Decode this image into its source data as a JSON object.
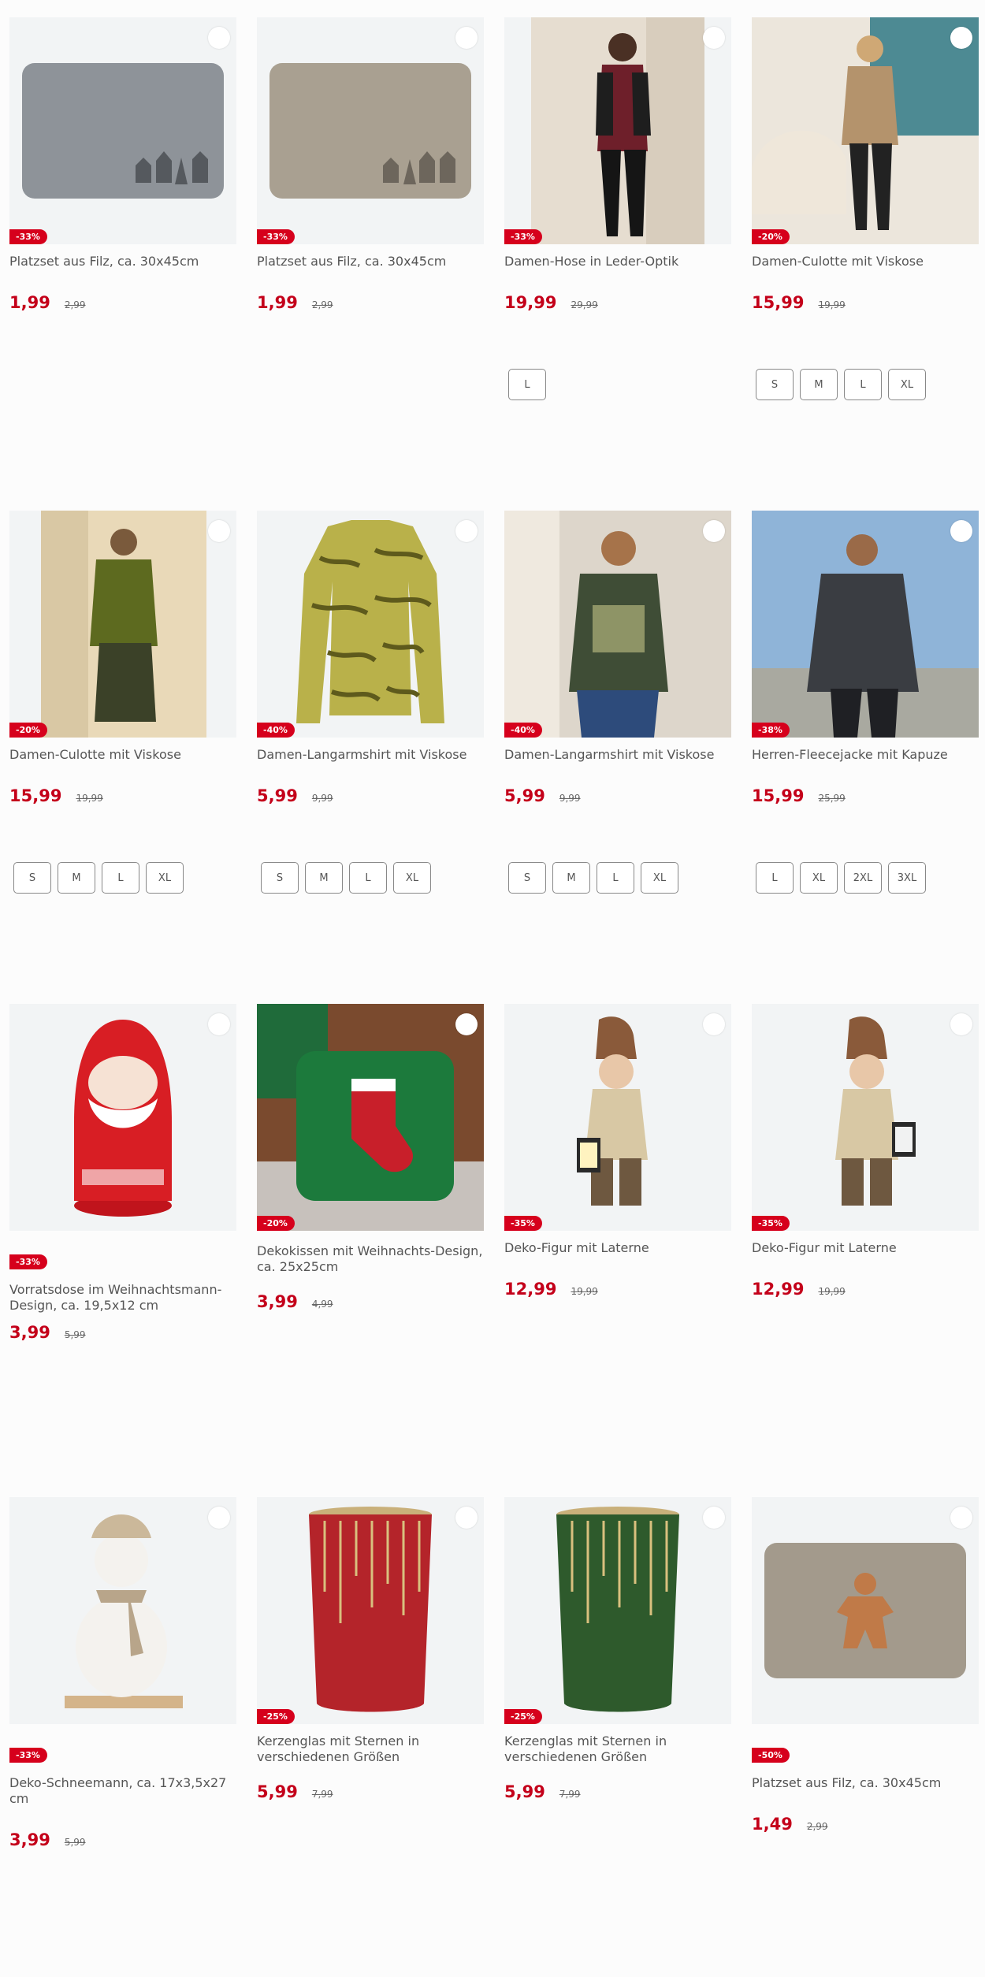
{
  "products": [
    {
      "name": "Platzset aus Filz, ca. 30x45cm",
      "badge": "-33%",
      "price": "1,99",
      "old_price": "2,99",
      "sizes": [],
      "image": "felt-mat-grey-houses"
    },
    {
      "name": "Platzset aus Filz, ca. 30x45cm",
      "badge": "-33%",
      "price": "1,99",
      "old_price": "2,99",
      "sizes": [],
      "image": "felt-mat-beige-houses"
    },
    {
      "name": "Damen-Hose in Leder-Optik",
      "badge": "-33%",
      "price": "19,99",
      "old_price": "29,99",
      "sizes": [
        "L"
      ],
      "image": "woman-leather-pants"
    },
    {
      "name": "Damen-Culotte mit Viskose",
      "badge": "-20%",
      "price": "15,99",
      "old_price": "19,99",
      "sizes": [
        "S",
        "M",
        "L",
        "XL"
      ],
      "image": "woman-culotte-beige-sweater"
    },
    {
      "name": "Damen-Culotte mit Viskose",
      "badge": "-20%",
      "price": "15,99",
      "old_price": "19,99",
      "sizes": [
        "S",
        "M",
        "L",
        "XL"
      ],
      "image": "woman-culotte-olive-jacket"
    },
    {
      "name": "Damen-Langarmshirt mit Viskose",
      "badge": "-40%",
      "price": "5,99",
      "old_price": "9,99",
      "sizes": [
        "S",
        "M",
        "L",
        "XL"
      ],
      "image": "zebra-print-shirt"
    },
    {
      "name": "Damen-Langarmshirt mit Viskose",
      "badge": "-40%",
      "price": "5,99",
      "old_price": "9,99",
      "sizes": [
        "S",
        "M",
        "L",
        "XL"
      ],
      "image": "woman-green-shirt"
    },
    {
      "name": "Herren-Fleecejacke mit Kapuze",
      "badge": "-38%",
      "price": "15,99",
      "old_price": "25,99",
      "sizes": [
        "L",
        "XL",
        "2XL",
        "3XL"
      ],
      "image": "man-fleece-jacket"
    },
    {
      "name": "Vorratsdose im Weihnachtsmann-Design, ca. 19,5x12 cm",
      "badge": "-33%",
      "price": "3,99",
      "old_price": "5,99",
      "sizes": [],
      "image": "santa-tin"
    },
    {
      "name": "Dekokissen mit Weihnachts-Design, ca. 25x25cm",
      "badge": "-20%",
      "price": "3,99",
      "old_price": "4,99",
      "sizes": [],
      "image": "stocking-cushion"
    },
    {
      "name": "Deko-Figur mit Laterne",
      "badge": "-35%",
      "price": "12,99",
      "old_price": "19,99",
      "sizes": [],
      "image": "figure-lantern-left"
    },
    {
      "name": "Deko-Figur mit Laterne",
      "badge": "-35%",
      "price": "12,99",
      "old_price": "19,99",
      "sizes": [],
      "image": "figure-lantern-right"
    },
    {
      "name": "Deko-Schneemann, ca. 17x3,5x27 cm",
      "badge": "-33%",
      "price": "3,99",
      "old_price": "5,99",
      "sizes": [],
      "image": "snowman"
    },
    {
      "name": "Kerzenglas mit Sternen in verschiedenen Größen",
      "badge": "-25%",
      "price": "5,99",
      "old_price": "7,99",
      "sizes": [],
      "image": "candle-glass-red"
    },
    {
      "name": "Kerzenglas mit Sternen in verschiedenen Größen",
      "badge": "-25%",
      "price": "5,99",
      "old_price": "7,99",
      "sizes": [],
      "image": "candle-glass-green"
    },
    {
      "name": "Platzset aus Filz, ca. 30x45cm",
      "badge": "-50%",
      "price": "1,49",
      "old_price": "2,99",
      "sizes": [],
      "image": "felt-mat-gingerbread"
    }
  ]
}
